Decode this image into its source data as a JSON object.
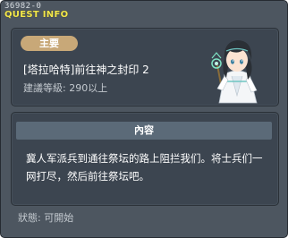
{
  "window": {
    "id": "36982-0",
    "title": "QUEST INFO"
  },
  "quest": {
    "badge": "主要",
    "name": "[塔拉哈特]前往神之封印 2",
    "level": "建議等級: 290以上",
    "npc_icon": "npc-portrait-icon"
  },
  "content": {
    "header": "內容",
    "text": "冀人军派兵到通往祭坛的路上阻拦我们。将士兵们一网打尽，然后前往祭坛吧。"
  },
  "status": "狀態: 可開始",
  "colors": {
    "title": "#f2e74c",
    "badge": "#c8a878",
    "panel": "#3c4550",
    "window": "#4d5660",
    "header_bar": "#5b6a78"
  }
}
